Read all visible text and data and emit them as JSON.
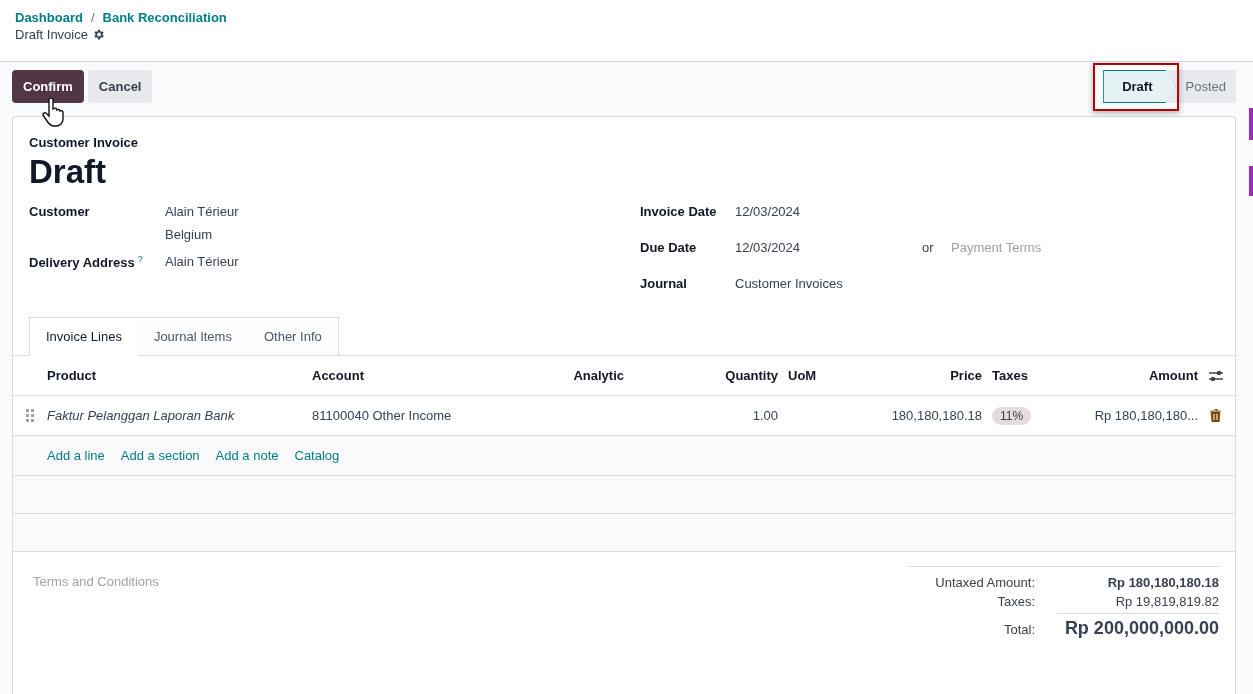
{
  "breadcrumbs": [
    "Dashboard",
    "Bank Reconciliation"
  ],
  "breadcrumb_separator": "/",
  "record_title": "Draft Invoice",
  "buttons": [
    {
      "label": "Confirm",
      "kind": "primary"
    },
    {
      "label": "Cancel",
      "kind": "secondary"
    }
  ],
  "stages": [
    {
      "label": "Draft",
      "selected": true,
      "highlighted": true
    },
    {
      "label": "Posted",
      "selected": false,
      "highlighted": false
    }
  ],
  "move_type": "Customer Invoice",
  "title": "Draft",
  "left_fields": [
    {
      "label": "Customer",
      "lines": [
        "Alain Térieur",
        "Belgium"
      ]
    },
    {
      "label": "Delivery Address",
      "lines": [
        "Alain Térieur"
      ],
      "help": "?"
    }
  ],
  "right_fields": [
    {
      "label": "Invoice Date",
      "value": "12/03/2024"
    },
    {
      "label": "Due Date",
      "value": "12/03/2024",
      "or": "or",
      "placeholder": "Payment Terms"
    },
    {
      "label": "Journal",
      "value": "Customer Invoices"
    }
  ],
  "tabs": [
    {
      "label": "Invoice Lines",
      "selected": true
    },
    {
      "label": "Journal Items",
      "selected": false
    },
    {
      "label": "Other Info",
      "selected": false
    }
  ],
  "columns": [
    "Product",
    "Account",
    "Analytic",
    "Quantity",
    "UoM",
    "Price",
    "Taxes",
    "Amount"
  ],
  "rows": [
    {
      "product": "Faktur Pelanggan Laporan Bank",
      "account": "81100040 Other Income",
      "quantity": "1.00",
      "price": "180,180,180.18",
      "taxes": [
        "11%"
      ],
      "amount": "Rp 180,180,180..."
    }
  ],
  "add_links": [
    "Add a line",
    "Add a section",
    "Add a note",
    "Catalog"
  ],
  "terms_placeholder": "Terms and Conditions",
  "totals": [
    {
      "label": "Untaxed Amount:",
      "value": "Rp 180,180,180.18",
      "kind": "subtotal"
    },
    {
      "label": "Taxes:",
      "value": "Rp 19,819,819.82",
      "kind": "tax"
    },
    {
      "label": "Total:",
      "value": "Rp 200,000,000.00",
      "kind": "total"
    }
  ]
}
